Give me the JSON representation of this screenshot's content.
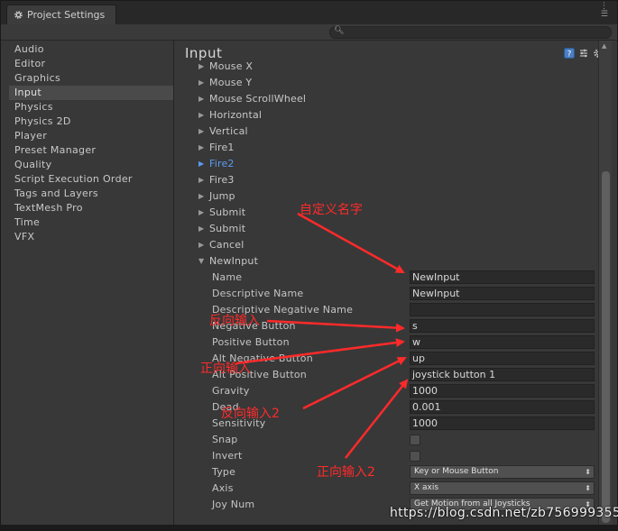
{
  "window": {
    "tab_title": "Project Settings"
  },
  "sidebar": {
    "items": [
      {
        "label": "Audio"
      },
      {
        "label": "Editor"
      },
      {
        "label": "Graphics"
      },
      {
        "label": "Input"
      },
      {
        "label": "Physics"
      },
      {
        "label": "Physics 2D"
      },
      {
        "label": "Player"
      },
      {
        "label": "Preset Manager"
      },
      {
        "label": "Quality"
      },
      {
        "label": "Script Execution Order"
      },
      {
        "label": "Tags and Layers"
      },
      {
        "label": "TextMesh Pro"
      },
      {
        "label": "Time"
      },
      {
        "label": "VFX"
      }
    ],
    "active": "Input"
  },
  "main": {
    "title": "Input",
    "axes": [
      {
        "label": "Mouse X"
      },
      {
        "label": "Mouse Y"
      },
      {
        "label": "Mouse ScrollWheel"
      },
      {
        "label": "Horizontal"
      },
      {
        "label": "Vertical"
      },
      {
        "label": "Fire1"
      },
      {
        "label": "Fire2"
      },
      {
        "label": "Fire3"
      },
      {
        "label": "Jump"
      },
      {
        "label": "Submit"
      },
      {
        "label": "Submit"
      },
      {
        "label": "Cancel"
      },
      {
        "label": "NewInput"
      }
    ],
    "selected_axis": "Fire2",
    "expanded_axis": "NewInput",
    "properties": [
      {
        "label": "Name",
        "value": "NewInput"
      },
      {
        "label": "Descriptive Name",
        "value": "NewInput"
      },
      {
        "label": "Descriptive Negative Name",
        "value": ""
      },
      {
        "label": "Negative Button",
        "value": "s"
      },
      {
        "label": "Positive Button",
        "value": "w"
      },
      {
        "label": "Alt Negative Button",
        "value": "up"
      },
      {
        "label": "Alt Positive Button",
        "value": "joystick button 1"
      },
      {
        "label": "Gravity",
        "value": "1000"
      },
      {
        "label": "Dead",
        "value": "0.001"
      },
      {
        "label": "Sensitivity",
        "value": "1000"
      },
      {
        "label": "Snap",
        "checked": false
      },
      {
        "label": "Invert",
        "checked": false
      },
      {
        "label": "Type",
        "selected": "Key or Mouse Button"
      },
      {
        "label": "Axis",
        "selected": "X axis"
      },
      {
        "label": "Joy Num",
        "selected": "Get Motion from all Joysticks"
      }
    ]
  },
  "annotations": {
    "custom_name": "自定义名字",
    "reverse_input": "反向输入",
    "forward_input": "正向输入",
    "reverse_input_2": "反向输入2",
    "forward_input_2": "正向输入2",
    "color": "#ff2a2a"
  },
  "watermark": "https://blog.csdn.net/zb756999355",
  "colors": {
    "selected_axis": "#5b9bf0",
    "panel_bg": "#383838",
    "field_bg": "#2a2a2a"
  }
}
